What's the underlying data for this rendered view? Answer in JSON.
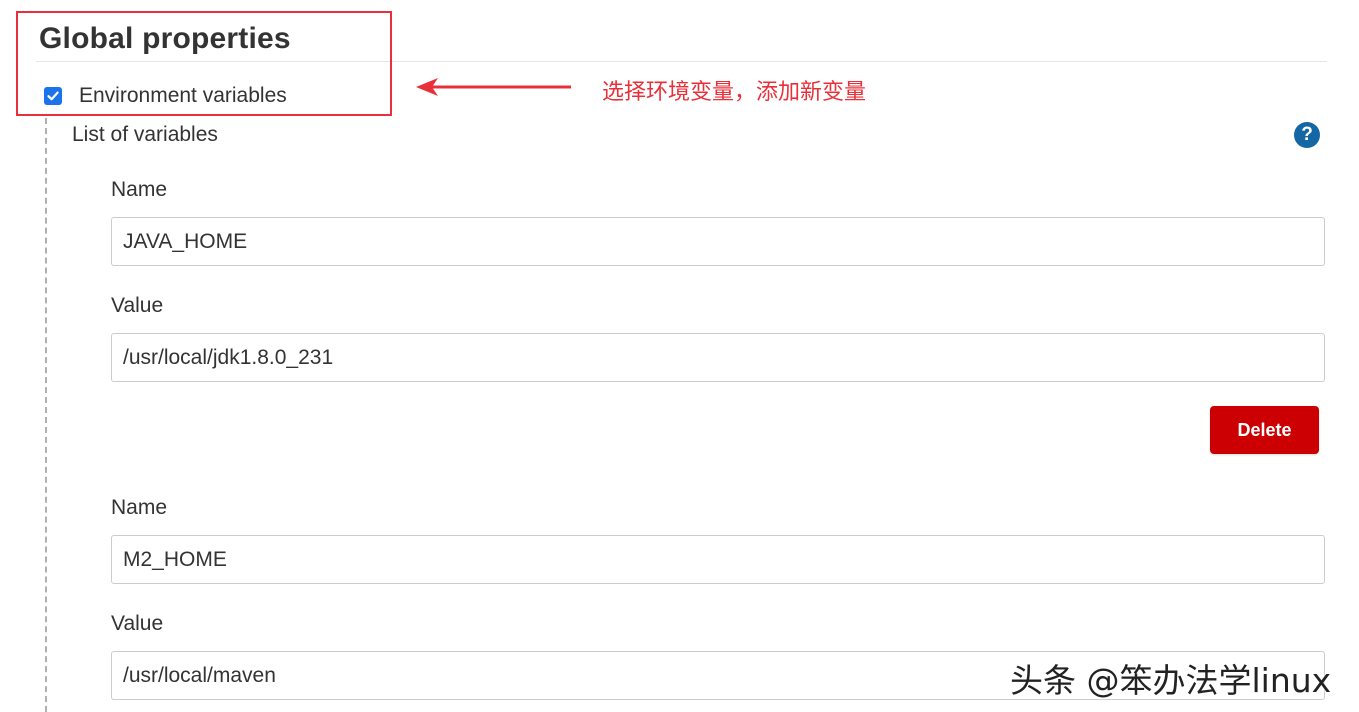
{
  "section": {
    "title": "Global properties",
    "env_checkbox_label": "Environment variables",
    "env_checkbox_checked": true
  },
  "annotation": {
    "text": "选择环境变量，添加新变量",
    "color": "#e8303a"
  },
  "list": {
    "title": "List of variables",
    "help_glyph": "?"
  },
  "variables": [
    {
      "name_label": "Name",
      "name_value": "JAVA_HOME",
      "value_label": "Value",
      "value_value": "/usr/local/jdk1.8.0_231",
      "delete_label": "Delete"
    },
    {
      "name_label": "Name",
      "name_value": "M2_HOME",
      "value_label": "Value",
      "value_value": "/usr/local/maven"
    }
  ],
  "watermark": "头条 @笨办法学linux",
  "colors": {
    "checkbox": "#1a73e8",
    "help_icon": "#1466a5",
    "delete_button": "#cc0003",
    "highlight": "#e8303a"
  }
}
